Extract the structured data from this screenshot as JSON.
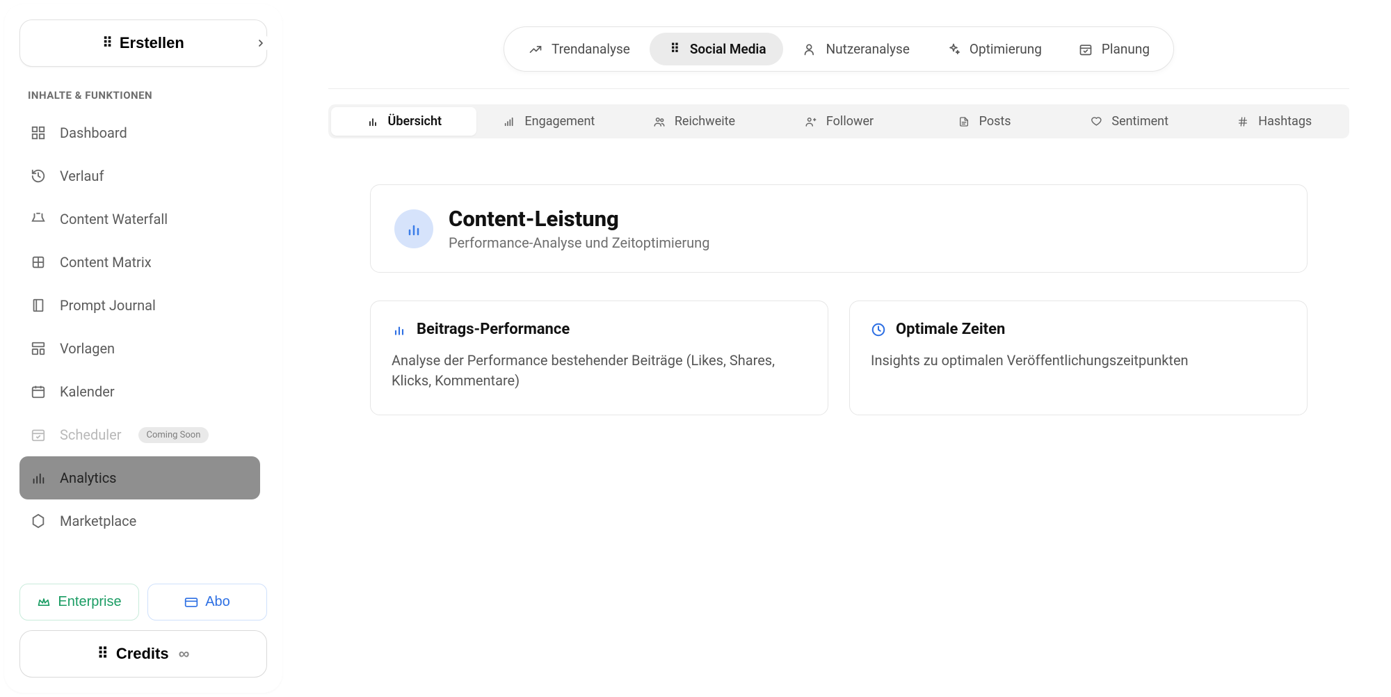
{
  "sidebar": {
    "create_label": "Erstellen",
    "section_label": "INHALTE & FUNKTIONEN",
    "items": [
      {
        "id": "dashboard",
        "label": "Dashboard"
      },
      {
        "id": "verlauf",
        "label": "Verlauf"
      },
      {
        "id": "content-waterfall",
        "label": "Content Waterfall"
      },
      {
        "id": "content-matrix",
        "label": "Content Matrix"
      },
      {
        "id": "prompt-journal",
        "label": "Prompt Journal"
      },
      {
        "id": "vorlagen",
        "label": "Vorlagen"
      },
      {
        "id": "kalender",
        "label": "Kalender"
      },
      {
        "id": "scheduler",
        "label": "Scheduler",
        "badge": "Coming Soon",
        "disabled": true
      },
      {
        "id": "analytics",
        "label": "Analytics",
        "active": true
      },
      {
        "id": "marketplace",
        "label": "Marketplace"
      }
    ],
    "enterprise_label": "Enterprise",
    "abo_label": "Abo",
    "credits_label": "Credits",
    "credits_symbol": "∞"
  },
  "topnav": [
    {
      "id": "trendanalyse",
      "label": "Trendanalyse"
    },
    {
      "id": "social-media",
      "label": "Social Media",
      "active": true
    },
    {
      "id": "nutzeranalyse",
      "label": "Nutzeranalyse"
    },
    {
      "id": "optimierung",
      "label": "Optimierung"
    },
    {
      "id": "planung",
      "label": "Planung"
    }
  ],
  "subtabs": [
    {
      "id": "uebersicht",
      "label": "Übersicht",
      "active": true
    },
    {
      "id": "engagement",
      "label": "Engagement"
    },
    {
      "id": "reichweite",
      "label": "Reichweite"
    },
    {
      "id": "follower",
      "label": "Follower"
    },
    {
      "id": "posts",
      "label": "Posts"
    },
    {
      "id": "sentiment",
      "label": "Sentiment"
    },
    {
      "id": "hashtags",
      "label": "Hashtags"
    }
  ],
  "header": {
    "title": "Content-Leistung",
    "subtitle": "Performance-Analyse und Zeitoptimierung"
  },
  "cards": [
    {
      "id": "beitrags-performance",
      "title": "Beitrags-Performance",
      "desc": "Analyse der Performance bestehender Beiträge (Likes, Shares, Klicks, Kommentare)",
      "icon": "bar"
    },
    {
      "id": "optimale-zeiten",
      "title": "Optimale Zeiten",
      "desc": "Insights zu optimalen Veröffentlichungszeitpunkten",
      "icon": "clock"
    }
  ]
}
